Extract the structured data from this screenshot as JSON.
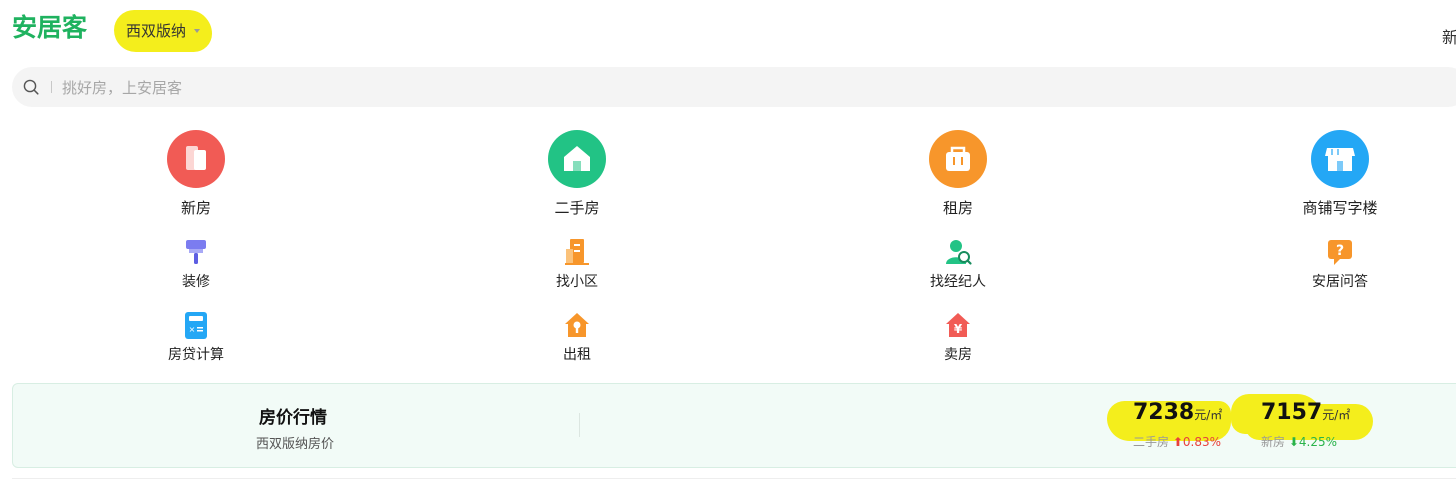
{
  "header": {
    "logo": "安居客",
    "city": "西双版纳",
    "right_nav": "新"
  },
  "search": {
    "placeholder": "挑好房，上安居客"
  },
  "nav_primary": [
    {
      "label": "新房",
      "icon": "new-house-icon",
      "color": "#f15b55"
    },
    {
      "label": "二手房",
      "icon": "second-hand-house-icon",
      "color": "#22c385"
    },
    {
      "label": "租房",
      "icon": "rent-house-icon",
      "color": "#f7962b"
    },
    {
      "label": "商铺写字楼",
      "icon": "shop-office-icon",
      "color": "#24a7f5"
    }
  ],
  "nav_secondary": [
    {
      "label": "装修",
      "icon": "decoration-icon"
    },
    {
      "label": "找小区",
      "icon": "community-icon"
    },
    {
      "label": "找经纪人",
      "icon": "agent-icon"
    },
    {
      "label": "安居问答",
      "icon": "qa-icon"
    },
    {
      "label": "房贷计算",
      "icon": "mortgage-calculator-icon"
    },
    {
      "label": "出租",
      "icon": "lease-icon"
    },
    {
      "label": "卖房",
      "icon": "sell-house-icon"
    }
  ],
  "price_trend": {
    "title": "房价行情",
    "subtitle": "西双版纳房价",
    "second_hand": {
      "price": "7238",
      "unit": "元/㎡",
      "label": "二手房",
      "change": "0.83%",
      "direction": "up"
    },
    "new_house": {
      "price": "7157",
      "unit": "元/㎡",
      "label": "新房",
      "change": "4.25%",
      "direction": "down"
    }
  }
}
